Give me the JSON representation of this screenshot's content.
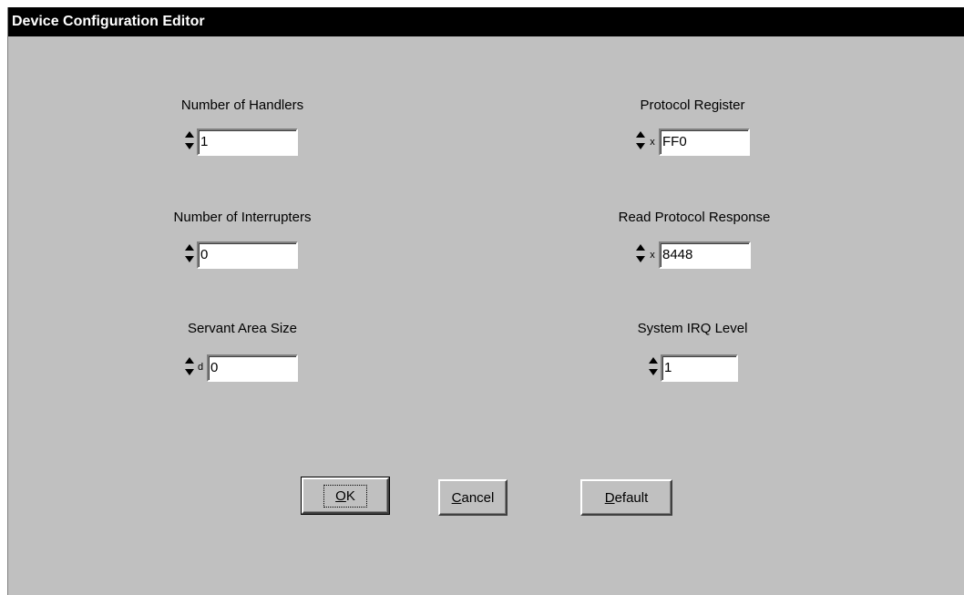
{
  "window": {
    "title": "Device Configuration Editor"
  },
  "fields": {
    "handlers": {
      "label": "Number of Handlers",
      "value": "1"
    },
    "interrupters": {
      "label": "Number of Interrupters",
      "value": "0"
    },
    "servant": {
      "label": "Servant Area Size",
      "radix": "d",
      "value": "0"
    },
    "protocol": {
      "label": "Protocol Register",
      "radix": "x",
      "value": "FF0"
    },
    "read_protocol": {
      "label": "Read Protocol Response",
      "radix": "x",
      "value": "8448"
    },
    "irq": {
      "label": "System IRQ Level",
      "value": "1"
    }
  },
  "buttons": {
    "ok": {
      "mnemonic": "O",
      "rest": "K"
    },
    "cancel": {
      "mnemonic": "C",
      "rest": "ancel"
    },
    "default": {
      "mnemonic": "D",
      "rest": "efault"
    }
  }
}
